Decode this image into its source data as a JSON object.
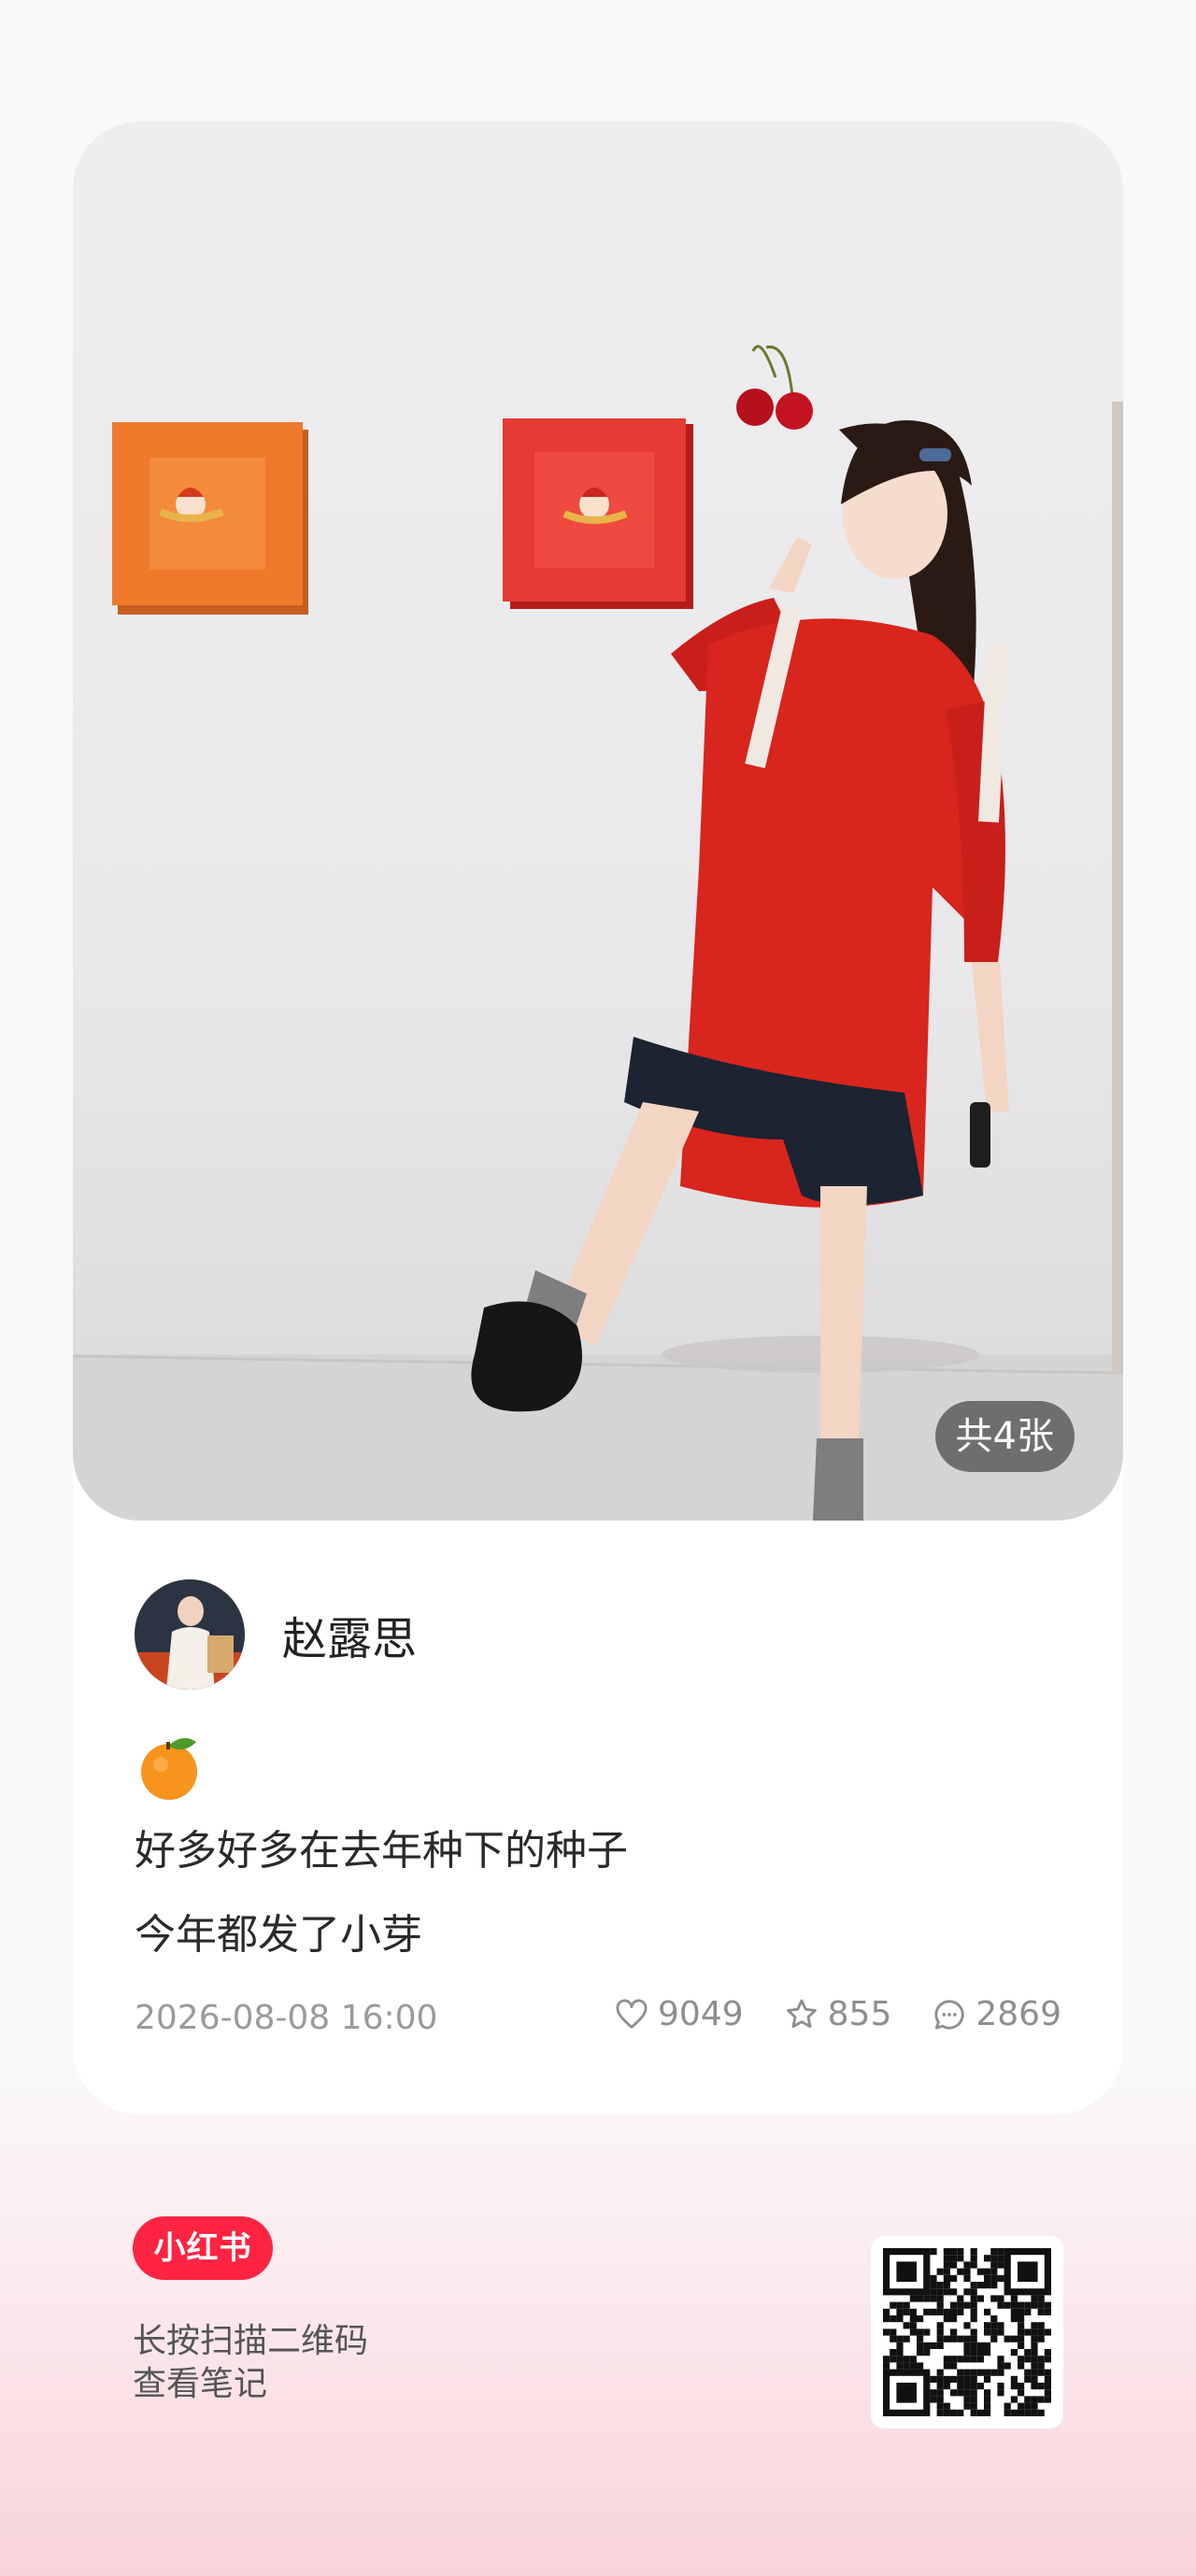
{
  "post": {
    "image_count_label": "共4张",
    "author_name": "赵露思",
    "emoji_icon": "tangerine-icon",
    "text_lines": [
      "好多好多在去年种下的种子",
      "今年都发了小芽"
    ],
    "date": "2026-08-08 16:00",
    "likes": "9049",
    "favorites": "855",
    "comments": "2869"
  },
  "footer": {
    "brand": "小红书",
    "scan_line1": "长按扫描二维码",
    "scan_line2": "查看笔记"
  },
  "colors": {
    "brand_red": "#ff2442",
    "shirt_red": "#d8251d",
    "frame_orange": "#ee7a2a"
  }
}
